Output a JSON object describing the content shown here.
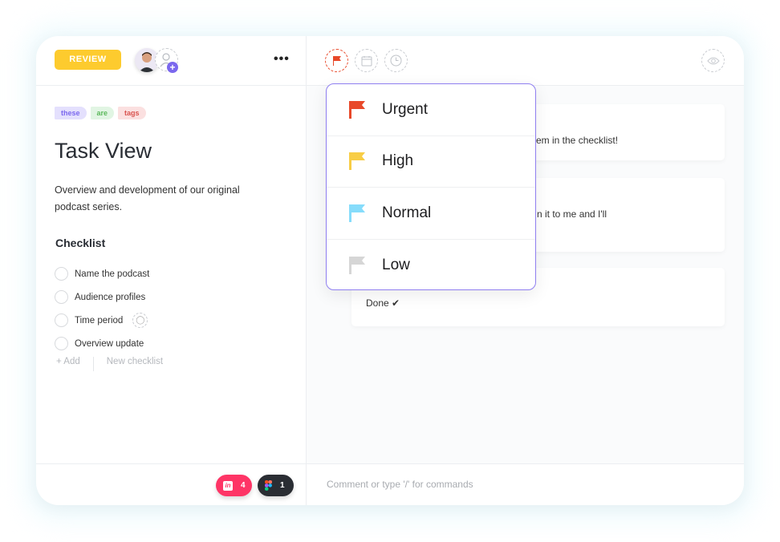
{
  "header": {
    "status": "REVIEW",
    "more_label": "•••"
  },
  "tags": [
    {
      "label": "these",
      "bg": "#e4e0fd",
      "fg": "#7b68ee"
    },
    {
      "label": "are",
      "bg": "#e1f5e3",
      "fg": "#5cb85c"
    },
    {
      "label": "tags",
      "bg": "#fbe0e0",
      "fg": "#d9534f"
    }
  ],
  "task": {
    "title": "Task View",
    "description": "Overview and development of our original podcast series."
  },
  "checklist": {
    "heading": "Checklist",
    "items": [
      "Name the podcast",
      "Audience profiles",
      "Time period",
      "Overview update"
    ],
    "add_label": "+ Add",
    "new_label": "New checklist"
  },
  "footer": {
    "invision_count": "4",
    "figma_count": "1"
  },
  "comments": {
    "items": [
      "item in the checklist!",
      "n it to me and I'll",
      "Done ✔"
    ],
    "placeholder": "Comment or type '/' for commands"
  },
  "priority_menu": {
    "options": [
      {
        "label": "Urgent",
        "color": "#e8492a"
      },
      {
        "label": "High",
        "color": "#f8cd45"
      },
      {
        "label": "Normal",
        "color": "#86dcfb"
      },
      {
        "label": "Low",
        "color": "#d6d6d6"
      }
    ]
  }
}
